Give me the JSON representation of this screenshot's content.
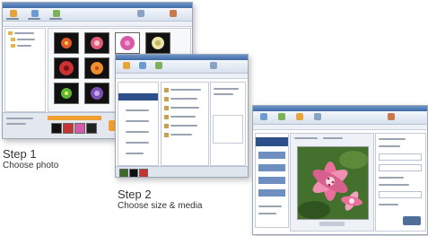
{
  "steps": [
    {
      "title": "Step 1",
      "subtitle": "Choose photo"
    },
    {
      "title": "Step 2",
      "subtitle": "Choose size & media"
    }
  ],
  "colors": {
    "titlebar": "#3f6aa6",
    "ribbon": "#d7e1ee",
    "accent_orange": "#f0a030",
    "photo_pink": "#d8608e",
    "leaf_green": "#3d6a28"
  },
  "icons": [
    "flower-thumbnail",
    "folder-icon",
    "toolbar-icon",
    "print-preview-photo"
  ]
}
